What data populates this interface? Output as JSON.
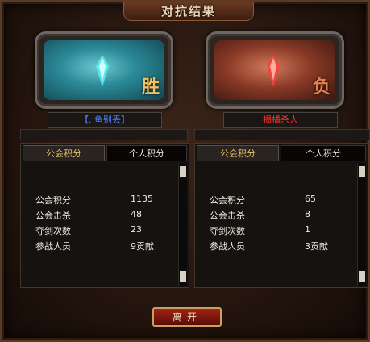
{
  "window": {
    "title": "对抗结果"
  },
  "left": {
    "result": "胜",
    "name": "【. 鱼别丢】",
    "tabs": [
      "公会积分",
      "个人积分"
    ],
    "stats": [
      {
        "label": "公会积分",
        "value": "1135"
      },
      {
        "label": "公会击杀",
        "value": "48"
      },
      {
        "label": "夺剑次数",
        "value": "23"
      },
      {
        "label": "参战人员",
        "value": "9贡献"
      }
    ]
  },
  "right": {
    "result": "负",
    "name": "揭橘杀人",
    "tabs": [
      "公会积分",
      "个人积分"
    ],
    "stats": [
      {
        "label": "公会积分",
        "value": "65"
      },
      {
        "label": "公会击杀",
        "value": "8"
      },
      {
        "label": "夺剑次数",
        "value": "1"
      },
      {
        "label": "参战人员",
        "value": "3贡献"
      }
    ]
  },
  "leave_label": "离开",
  "colors": {
    "win_name": "#4a7aff",
    "lose_name": "#ff3030",
    "active_tab": "#e8c070"
  }
}
